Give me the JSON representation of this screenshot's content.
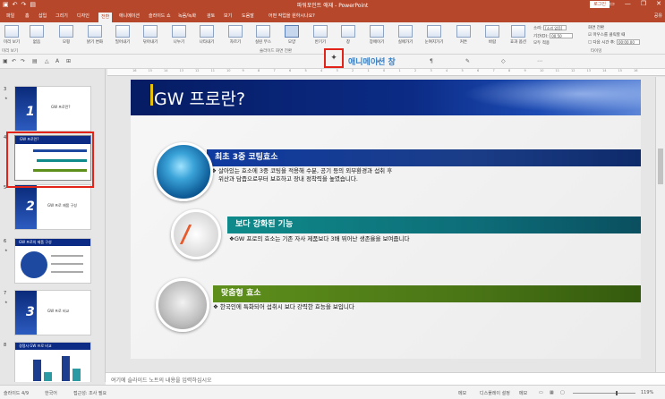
{
  "window": {
    "title": "파워포인트 애재 - PowerPoint",
    "login_label": "로그인",
    "qat_icons": [
      "save-icon",
      "undo-icon",
      "redo-icon",
      "start-icon"
    ],
    "win_buttons": [
      "▭",
      "—",
      "❐",
      "✕"
    ]
  },
  "tabs": [
    "파일",
    "홈",
    "삽입",
    "그리기",
    "디자인",
    "전환",
    "애니메이션",
    "슬라이드 쇼",
    "녹음/녹화",
    "검토",
    "보기",
    "도움말"
  ],
  "tell_me": "어떤 작업을 원하시나요?",
  "share_label": "공유",
  "ribbon": {
    "preview": "미리\n보기",
    "transitions": [
      "없음",
      "모핑",
      "밝기 변화",
      "밀어내기",
      "닦아내기",
      "나누기",
      "나타내기",
      "자르기",
      "실린 무스",
      "모양",
      "반기기",
      "창",
      "장애이기",
      "실에가기",
      "눈여지가기",
      "커튼",
      "바람"
    ],
    "effects_label": "효과\n옵션",
    "group_preview": "미리 보기",
    "group_transitions": "슬라이드 화면 전환",
    "group_timing": "타이밍",
    "sound_label": "소리:",
    "sound_value": "[소리 없음]",
    "duration_label": "기간(D):",
    "duration_value": "00.50",
    "apply_all": "모두 적용",
    "advance_label": "화면 전환",
    "on_click": "마우스를 클릭할 때",
    "after_label": "다음 시간 후:",
    "after_value": "00:00.00"
  },
  "animation_pane_label": "애니메이션 창",
  "ruler_labels": [
    "16",
    "15",
    "14",
    "13",
    "12",
    "11",
    "10",
    "9",
    "8",
    "7",
    "6",
    "5",
    "4",
    "3",
    "2",
    "1",
    "0",
    "1",
    "2",
    "3",
    "4",
    "5",
    "6",
    "7",
    "8",
    "9",
    "10",
    "11",
    "12",
    "13",
    "14",
    "15",
    "16"
  ],
  "thumbnails": [
    {
      "num": "3",
      "big": "1",
      "caption": "GW 프로란?"
    },
    {
      "num": "4",
      "big": "",
      "caption": "GW 프로란?"
    },
    {
      "num": "5",
      "big": "2",
      "caption": "GW 프로 제품 구성"
    },
    {
      "num": "6",
      "big": "",
      "caption": "GW 프로의 제품 구성"
    },
    {
      "num": "7",
      "big": "3",
      "caption": "GW 프로 비교"
    },
    {
      "num": "8",
      "big": "",
      "caption": "경쟁사 GW 프로 비교"
    }
  ],
  "slide": {
    "title": "GW 프로란?",
    "items": [
      {
        "heading": "최초 3중 코팅효소",
        "lines": [
          "❖ 살아있는 효소에 3중 코팅을 적용해 수분, 공기 등의 외부환경과 섭취 후",
          "위산과 담즙으로부터 보호하고 장내 정착력을 높였습니다."
        ]
      },
      {
        "heading": "보다 강화된 기능",
        "lines": [
          "❖GW 프로의 효소는 기존 자사 제품보다 3배 뛰어난 생존율을 보여줍니다"
        ]
      },
      {
        "heading": "맞춤형 효소",
        "lines": [
          "❖ 한국인에 특화되어 섭취시 보다 강력한 효능을 보입니다"
        ]
      }
    ]
  },
  "notes_placeholder": "여기에 슬라이드 노트의 내용을 입력하십시오",
  "status": {
    "slide_info": "슬라이드 4/9",
    "language": "한국어",
    "accessibility": "접근성: 조사 필요",
    "notes": "메모",
    "display_settings": "디스플레이 설정",
    "comments": "메모",
    "zoom": "119%"
  }
}
